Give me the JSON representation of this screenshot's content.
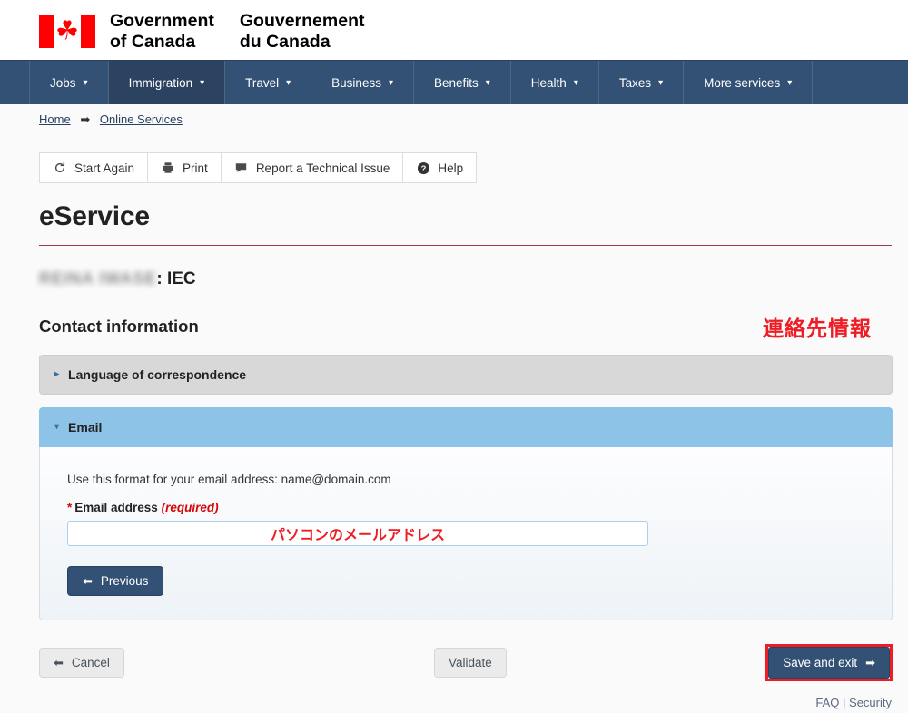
{
  "header": {
    "wordmark_en_line1": "Government",
    "wordmark_en_line2": "of Canada",
    "wordmark_fr_line1": "Gouvernement",
    "wordmark_fr_line2": "du Canada",
    "flag_leaf": "☘"
  },
  "nav": {
    "items": [
      {
        "label": "Jobs",
        "active": false
      },
      {
        "label": "Immigration",
        "active": true
      },
      {
        "label": "Travel",
        "active": false
      },
      {
        "label": "Business",
        "active": false
      },
      {
        "label": "Benefits",
        "active": false
      },
      {
        "label": "Health",
        "active": false
      },
      {
        "label": "Taxes",
        "active": false
      },
      {
        "label": "More services",
        "active": false
      }
    ],
    "caret": "▾",
    "background": "#335075",
    "active_background": "#2b4360"
  },
  "breadcrumb": {
    "home": "Home",
    "arrow": "➡",
    "current": "Online Services"
  },
  "toolbar": {
    "start_again": "Start Again",
    "print": "Print",
    "report_issue": "Report a Technical Issue",
    "help": "Help"
  },
  "main": {
    "page_title": "eService",
    "applicant_name_redacted": "REINA IWASE",
    "applicant_program": ": IEC",
    "section_title": "Contact information",
    "japanese_annotation": "連絡先情報",
    "annotation_color": "#ee1c25"
  },
  "accordions": [
    {
      "title": "Language of correspondence",
      "state": "collapsed",
      "marker": "▸"
    },
    {
      "title": "Email",
      "state": "expanded",
      "marker": "▾"
    }
  ],
  "email_panel": {
    "hint": "Use this format for your email address: name@domain.com",
    "field_label": "Email address",
    "required_marker": "*",
    "required_text": "(required)",
    "input_value": "パソコンのメールアドレス",
    "input_placeholder": "",
    "previous_label": "Previous",
    "previous_arrow": "⬅"
  },
  "actions": {
    "cancel_label": "Cancel",
    "cancel_arrow": "⬅",
    "validate_label": "Validate",
    "save_label": "Save and exit",
    "save_arrow": "➡",
    "save_highlight_color": "#ee1c25"
  },
  "footer": {
    "faq": "FAQ",
    "separator": "|",
    "security": "Security"
  }
}
